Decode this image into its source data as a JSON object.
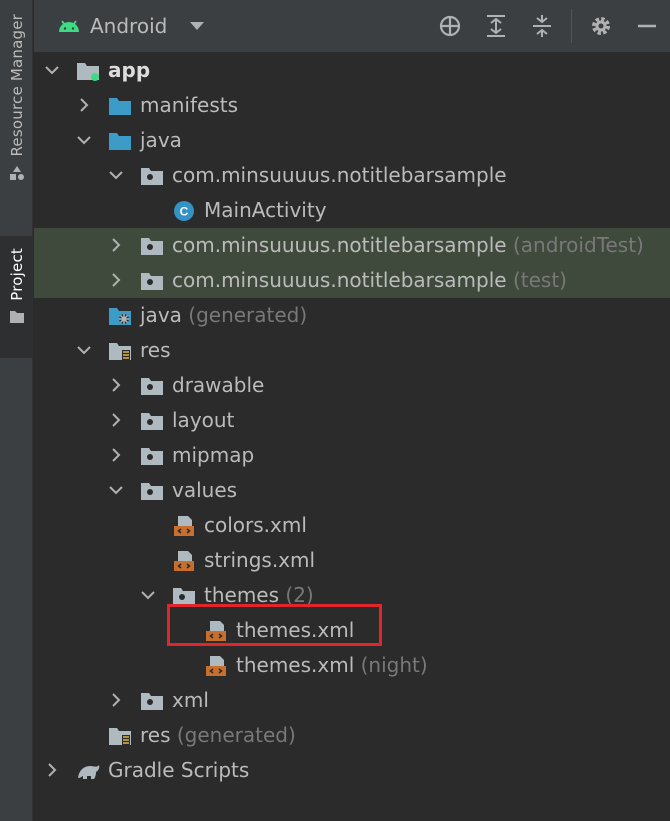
{
  "sidebar": {
    "resource_manager_label": "Resource Manager",
    "project_label": "Project"
  },
  "toolbar": {
    "view_label": "Android",
    "icons": [
      "locate-icon",
      "expand-all-icon",
      "collapse-all-icon",
      "gear-icon",
      "minimize-icon"
    ]
  },
  "tree": {
    "app": "app",
    "manifests": "manifests",
    "java": "java",
    "pkg_main": "com.minsuuuus.notitlebarsample",
    "main_activity": "MainActivity",
    "pkg_android_test": "com.minsuuuus.notitlebarsample",
    "pkg_android_test_suffix": "(androidTest)",
    "pkg_test": "com.minsuuuus.notitlebarsample",
    "pkg_test_suffix": "(test)",
    "java_generated": "java",
    "java_generated_suffix": "(generated)",
    "res": "res",
    "drawable": "drawable",
    "layout": "layout",
    "mipmap": "mipmap",
    "values": "values",
    "colors_xml": "colors.xml",
    "strings_xml": "strings.xml",
    "themes": "themes",
    "themes_count": "(2)",
    "themes_xml": "themes.xml",
    "themes_xml_night": "themes.xml",
    "themes_xml_night_suffix": "(night)",
    "xml": "xml",
    "res_generated": "res",
    "res_generated_suffix": "(generated)",
    "gradle_scripts": "Gradle Scripts"
  },
  "colors": {
    "android_green": "#3ddc84",
    "folder_blue": "#3d9bc8",
    "folder_gray": "#aeb9c0",
    "xml_orange": "#c86f2e",
    "class_blue": "#3592c4",
    "highlight_red": "#e0262a"
  }
}
